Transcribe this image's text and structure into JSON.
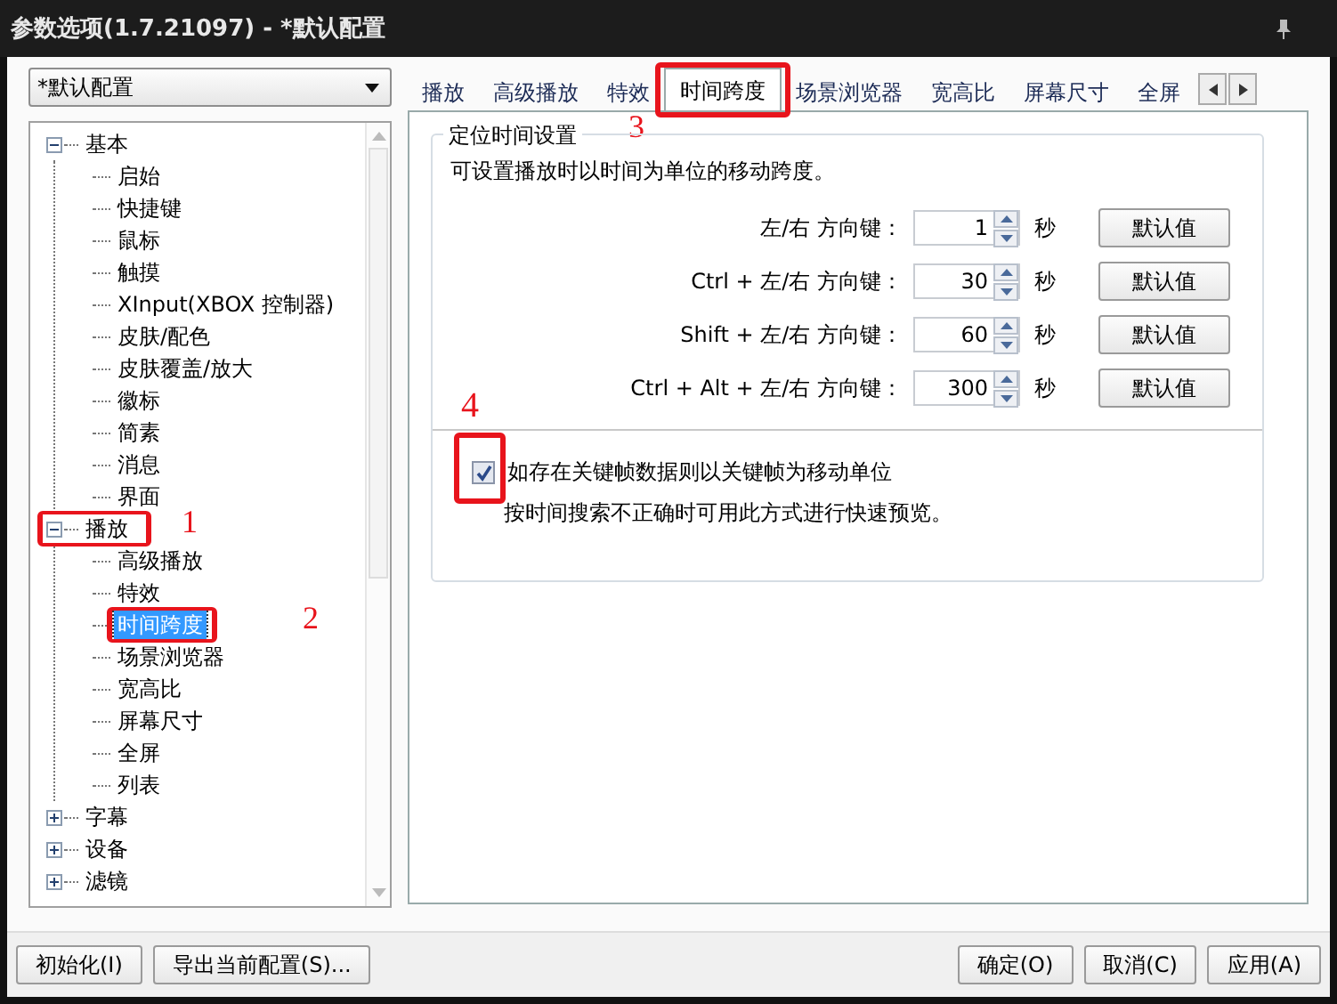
{
  "window": {
    "title": "参数选项(1.7.21097) - *默认配置"
  },
  "profile_select": {
    "value": "*默认配置"
  },
  "tree": [
    {
      "label": "基本",
      "expanded": true,
      "selected": false,
      "children": [
        {
          "label": "启始",
          "selected": false
        },
        {
          "label": "快捷键",
          "selected": false
        },
        {
          "label": "鼠标",
          "selected": false
        },
        {
          "label": "触摸",
          "selected": false
        },
        {
          "label": "XInput(XBOX 控制器)",
          "selected": false
        },
        {
          "label": "皮肤/配色",
          "selected": false
        },
        {
          "label": "皮肤覆盖/放大",
          "selected": false
        },
        {
          "label": "徽标",
          "selected": false
        },
        {
          "label": "简素",
          "selected": false
        },
        {
          "label": "消息",
          "selected": false
        },
        {
          "label": "界面",
          "selected": false
        }
      ]
    },
    {
      "label": "播放",
      "expanded": true,
      "selected": false,
      "annotation": "1",
      "children": [
        {
          "label": "高级播放",
          "selected": false
        },
        {
          "label": "特效",
          "selected": false
        },
        {
          "label": "时间跨度",
          "selected": true,
          "annotation": "2"
        },
        {
          "label": "场景浏览器",
          "selected": false
        },
        {
          "label": "宽高比",
          "selected": false
        },
        {
          "label": "屏幕尺寸",
          "selected": false
        },
        {
          "label": "全屏",
          "selected": false
        },
        {
          "label": "列表",
          "selected": false
        }
      ]
    },
    {
      "label": "字幕",
      "expanded": false,
      "selected": false
    },
    {
      "label": "设备",
      "expanded": false,
      "selected": false
    },
    {
      "label": "滤镜",
      "expanded": false,
      "selected": false
    }
  ],
  "tabs": [
    {
      "label": "播放",
      "selected": false
    },
    {
      "label": "高级播放",
      "selected": false
    },
    {
      "label": "特效",
      "selected": false
    },
    {
      "label": "时间跨度",
      "selected": true,
      "annotation": "3"
    },
    {
      "label": "场景浏览器",
      "selected": false
    },
    {
      "label": "宽高比",
      "selected": false
    },
    {
      "label": "屏幕尺寸",
      "selected": false
    },
    {
      "label": "全屏",
      "selected": false
    }
  ],
  "group": {
    "title": "定位时间设置",
    "description": "可设置播放时以时间为单位的移动跨度。",
    "rows": [
      {
        "label": "左/右 方向键：",
        "value": "1",
        "unit": "秒",
        "button": "默认值"
      },
      {
        "label": "Ctrl + 左/右 方向键：",
        "value": "30",
        "unit": "秒",
        "button": "默认值"
      },
      {
        "label": "Shift + 左/右 方向键：",
        "value": "60",
        "unit": "秒",
        "button": "默认值"
      },
      {
        "label": "Ctrl + Alt + 左/右 方向键：",
        "value": "300",
        "unit": "秒",
        "button": "默认值"
      }
    ]
  },
  "keyframe_option": {
    "label": "如存在关键帧数据则以关键帧为移动单位",
    "checked": true,
    "note": "按时间搜索不正确时可用此方式进行快速预览。",
    "annotation": "4"
  },
  "footer": {
    "left_buttons": [
      "初始化(I)",
      "导出当前配置(S)..."
    ],
    "right_buttons": [
      "确定(O)",
      "取消(C)",
      "应用(A)"
    ]
  }
}
